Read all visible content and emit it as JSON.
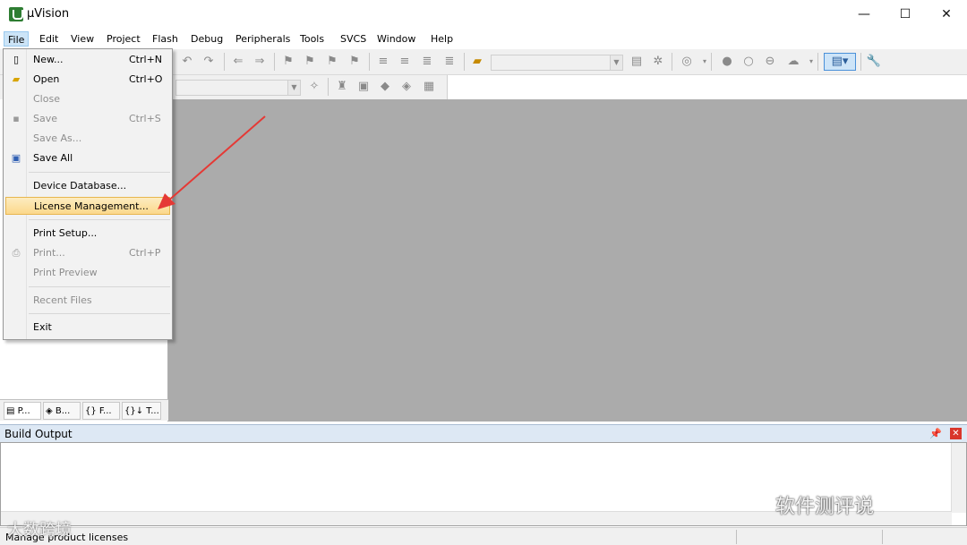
{
  "window": {
    "title": "µVision",
    "minimize": "—",
    "maximize": "☐",
    "close": "✕"
  },
  "menubar": [
    "File",
    "Edit",
    "View",
    "Project",
    "Flash",
    "Debug",
    "Peripherals",
    "Tools",
    "SVCS",
    "Window",
    "Help"
  ],
  "file_menu": {
    "new": {
      "label": "New...",
      "shortcut": "Ctrl+N"
    },
    "open": {
      "label": "Open",
      "shortcut": "Ctrl+O"
    },
    "close": {
      "label": "Close"
    },
    "save": {
      "label": "Save",
      "shortcut": "Ctrl+S"
    },
    "save_as": {
      "label": "Save As..."
    },
    "save_all": {
      "label": "Save All"
    },
    "device_database": {
      "label": "Device Database..."
    },
    "license_management": {
      "label": "License Management..."
    },
    "print_setup": {
      "label": "Print Setup..."
    },
    "print": {
      "label": "Print...",
      "shortcut": "Ctrl+P"
    },
    "print_preview": {
      "label": "Print Preview"
    },
    "recent_files": {
      "label": "Recent Files"
    },
    "exit": {
      "label": "Exit"
    }
  },
  "pane_tabs": [
    "P...",
    "B...",
    "F...",
    "T..."
  ],
  "build_output": {
    "title": "Build Output"
  },
  "status": {
    "text": "Manage product licenses"
  },
  "watermarks": {
    "right": "软件测评说",
    "left": "大数跨境"
  },
  "colors": {
    "highlight": "#fbd88b",
    "editor_bg": "#ababab",
    "arrow": "#e53935"
  }
}
